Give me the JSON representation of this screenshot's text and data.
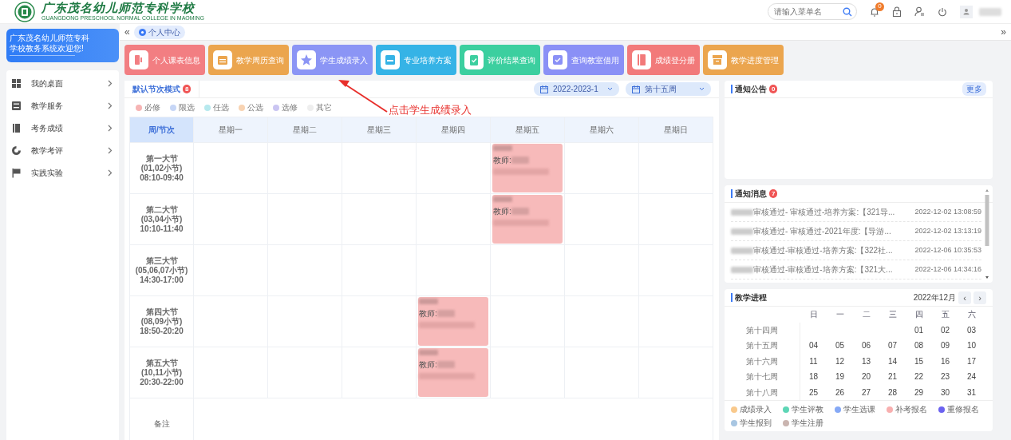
{
  "header": {
    "school_name": "广东茂名幼儿师范专科学校",
    "school_name_en": "GUANGDONG PRESCHOOL NORMAL COLLEGE IN MAOMING",
    "search": {
      "placeholder": "请输入菜单名"
    },
    "notification_count": "0"
  },
  "sidebar": {
    "welcome": "广东茂名幼儿师范专科学校教务系统欢迎您!",
    "items": [
      {
        "label": "我的桌面",
        "kind": "windows"
      },
      {
        "label": "教学服务",
        "kind": "checklist"
      },
      {
        "label": "考务成绩",
        "kind": "book"
      },
      {
        "label": "教学考评",
        "kind": "target"
      },
      {
        "label": "实践实验",
        "kind": "flag"
      }
    ]
  },
  "tabbar": {
    "collapse": "«",
    "expand": "»",
    "tabs": [
      {
        "label": "个人中心",
        "selected": true
      }
    ]
  },
  "quick_links": [
    {
      "label": "个人课表信息",
      "color": "#f27e82",
      "kind": "door"
    },
    {
      "label": "教学周历查询",
      "color": "#eba54e",
      "kind": "calendar"
    },
    {
      "label": "学生成绩录入",
      "color": "#8b95f5",
      "kind": "star"
    },
    {
      "label": "专业培养方案",
      "color": "#35b3e6",
      "kind": "tray"
    },
    {
      "label": "评价结果查询",
      "color": "#3ccf9f",
      "kind": "clipboard"
    },
    {
      "label": "查询教室借用",
      "color": "#8a90f6",
      "kind": "check"
    },
    {
      "label": "成绩登分册",
      "color": "#f27a7a",
      "kind": "book"
    },
    {
      "label": "教学进度管理",
      "color": "#eba54e",
      "kind": "box"
    }
  ],
  "annotation": {
    "text": "点击学生成绩录入"
  },
  "timetable": {
    "mode": "默认节次模式",
    "mode_count": "8",
    "term": "2022-2023-1",
    "week": "第十五周",
    "legend": [
      {
        "label": "必修",
        "color": "#f6b4b4"
      },
      {
        "label": "限选",
        "color": "#c6d6f6"
      },
      {
        "label": "任选",
        "color": "#b7e9ee"
      },
      {
        "label": "公选",
        "color": "#f8d3b2"
      },
      {
        "label": "选修",
        "color": "#cac5f2"
      },
      {
        "label": "其它",
        "color": "#eeeeee"
      }
    ],
    "corner": "周/节次",
    "days": [
      "星期一",
      "星期二",
      "星期三",
      "星期四",
      "星期五",
      "星期六",
      "星期日"
    ],
    "periods": [
      {
        "name": "第一大节",
        "slots": "(01,02小节)",
        "time": "08:10-09:40",
        "cells": [
          null,
          null,
          null,
          null,
          {
            "teacher_label": "教师:"
          },
          null,
          null
        ]
      },
      {
        "name": "第二大节",
        "slots": "(03,04小节)",
        "time": "10:10-11:40",
        "cells": [
          null,
          null,
          null,
          null,
          {
            "teacher_label": "教师:"
          },
          null,
          null
        ]
      },
      {
        "name": "第三大节",
        "slots": "(05,06,07小节)",
        "time": "14:30-17:00",
        "cells": [
          null,
          null,
          null,
          null,
          null,
          null,
          null
        ]
      },
      {
        "name": "第四大节",
        "slots": "(08,09小节)",
        "time": "18:50-20:20",
        "cells": [
          null,
          null,
          null,
          {
            "teacher_label": "教师:"
          },
          null,
          null,
          null
        ]
      },
      {
        "name": "第五大节",
        "slots": "(10,11小节)",
        "time": "20:30-22:00",
        "cells": [
          null,
          null,
          null,
          {
            "teacher_label": "教师:"
          },
          null,
          null,
          null
        ]
      }
    ],
    "remarks_label": "备注"
  },
  "notices": {
    "title": "通知公告",
    "count": "0",
    "more": "更多"
  },
  "messages": {
    "title": "通知消息",
    "count": "7",
    "items": [
      {
        "text": "审核通过- 审核通过-培养方案:【321导...",
        "time": "2022-12-02 13:08:59"
      },
      {
        "text": "审核通过- 审核通过-2021年度:【导游...",
        "time": "2022-12-02 13:13:19"
      },
      {
        "text": "审核通过-审核通过-培养方案:【322社...",
        "time": "2022-12-06 10:35:53"
      },
      {
        "text": "审核通过-审核通过-培养方案:【321大...",
        "time": "2022-12-06 14:34:16"
      }
    ]
  },
  "calendar": {
    "title": "教学进程",
    "month": "2022年12月",
    "prev": "‹",
    "next": "›",
    "weekdays": [
      "日",
      "一",
      "二",
      "三",
      "四",
      "五",
      "六"
    ],
    "weeks": [
      {
        "label": "第十四周",
        "days": [
          "01",
          "02",
          "03"
        ]
      },
      {
        "label": "第十五周",
        "days": [
          "04",
          "05",
          "06",
          "07",
          "08",
          "09",
          "10"
        ]
      },
      {
        "label": "第十六周",
        "days": [
          "11",
          "12",
          "13",
          "14",
          "15",
          "16",
          "17"
        ]
      },
      {
        "label": "第十七周",
        "days": [
          "18",
          "19",
          "20",
          "21",
          "22",
          "23",
          "24"
        ]
      },
      {
        "label": "第十八周",
        "days": [
          "25",
          "26",
          "27",
          "28",
          "29",
          "30",
          "31"
        ]
      }
    ],
    "legend": [
      {
        "label": "成绩录入",
        "color": "#f9c98c"
      },
      {
        "label": "学生评教",
        "color": "#5ed6b6"
      },
      {
        "label": "学生选课",
        "color": "#86a9f6"
      },
      {
        "label": "补考报名",
        "color": "#f8afaf"
      },
      {
        "label": "重修报名",
        "color": "#6b62f0"
      },
      {
        "label": "学生报到",
        "color": "#a8c6e2"
      },
      {
        "label": "学生注册",
        "color": "#cab5b0"
      }
    ]
  }
}
